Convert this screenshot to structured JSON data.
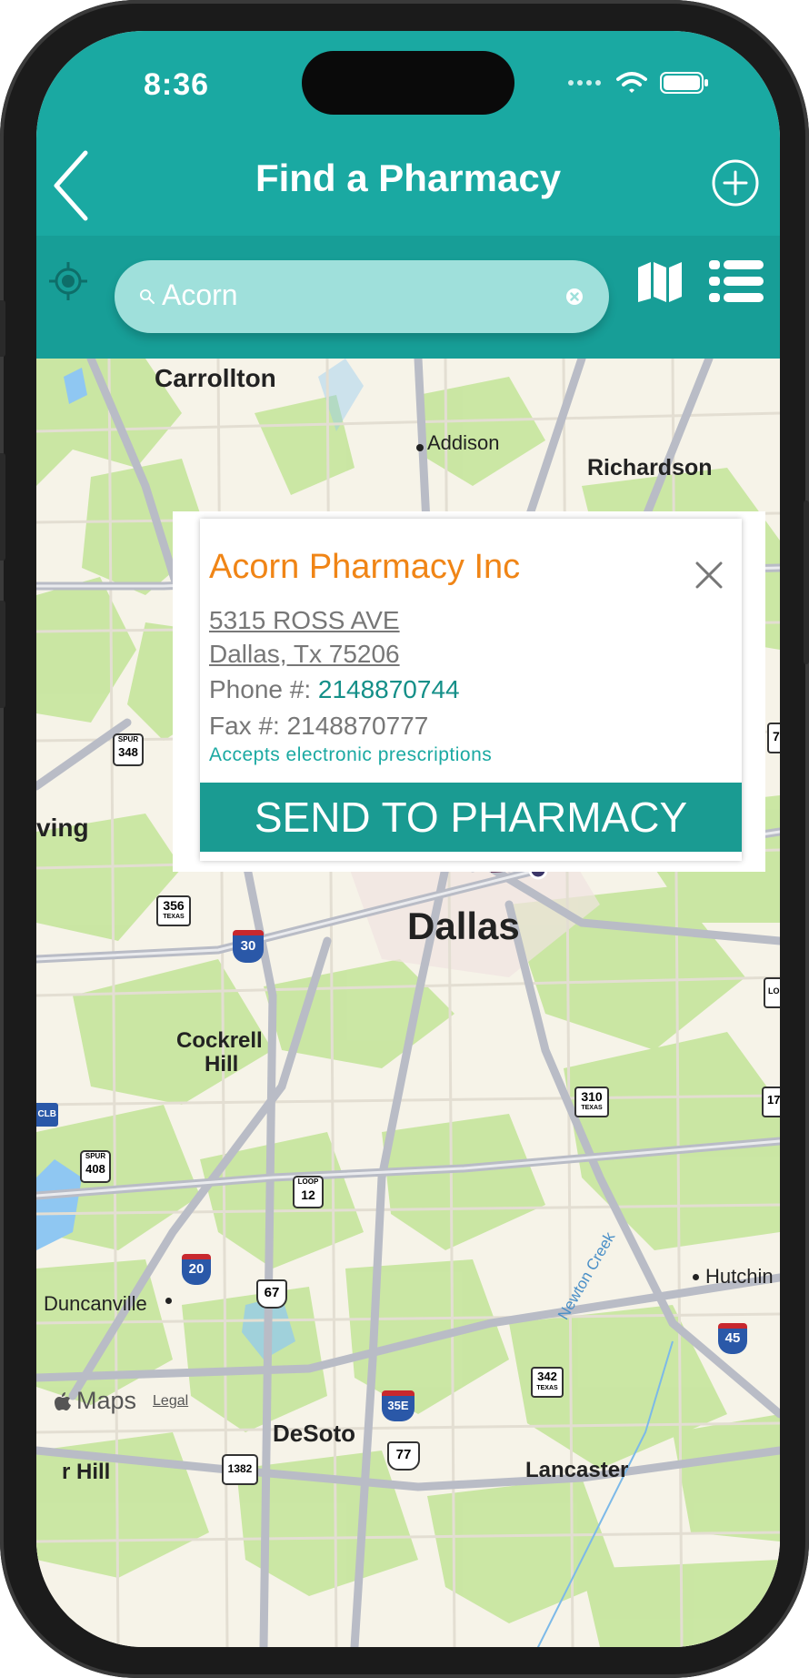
{
  "status": {
    "time": "8:36"
  },
  "nav": {
    "title": "Find a Pharmacy"
  },
  "search": {
    "value": "Acorn"
  },
  "map": {
    "labels": {
      "carrollton": "Carrollton",
      "addison": "Addison",
      "richardson": "Richardson",
      "irving": "ving",
      "dallas": "Dallas",
      "cockrell_1": "Cockrell",
      "cockrell_2": "Hill",
      "duncanville": "Duncanville",
      "desoto": "DeSoto",
      "lancaster": "Lancaster",
      "hutchins": "Hutchin",
      "cedar_hill": "r Hill",
      "newton_creek": "Newton Creek"
    },
    "shields": {
      "spur348_top": "SPUR",
      "spur348": "348",
      "tx356": "356",
      "tx356_sub": "TEXAS",
      "i30": "30",
      "us77_top": "77",
      "tx310": "310",
      "tx310_sub": "TEXAS",
      "spur408_top": "SPUR",
      "spur408": "408",
      "loop12_top": "LOOP",
      "loop12": "12",
      "i20": "20",
      "us67": "67",
      "i35e": "35E",
      "tx342": "342",
      "tx342_sub": "TEXAS",
      "us77_bottom": "77",
      "tx1382": "1382",
      "i45": "45",
      "cut_7": "7",
      "cut_17": "17",
      "cut_l": "LO",
      "cut_clb": "CLB"
    },
    "attribution": {
      "brand": "Maps",
      "legal": "Legal"
    }
  },
  "pharmacy": {
    "name": "Acorn Pharmacy Inc",
    "address_line1": "5315 ROSS AVE",
    "address_line2": "Dallas, Tx 75206",
    "phone_label": "Phone #: ",
    "phone": "2148870744",
    "fax_label": "Fax #: ",
    "fax": "2148870777",
    "eprescribe": "Accepts electronic prescriptions",
    "send_label": "SEND TO PHARMACY"
  },
  "colors": {
    "header": "#1aa9a2",
    "accent_orange": "#f08516",
    "send_button": "#1a9b92"
  },
  "icons": [
    "back-chevron-icon",
    "add-circle-icon",
    "locate-icon",
    "search-icon",
    "clear-icon",
    "map-icon",
    "list-icon",
    "close-icon",
    "pharmacy-pin-icon",
    "apple-logo-icon"
  ]
}
